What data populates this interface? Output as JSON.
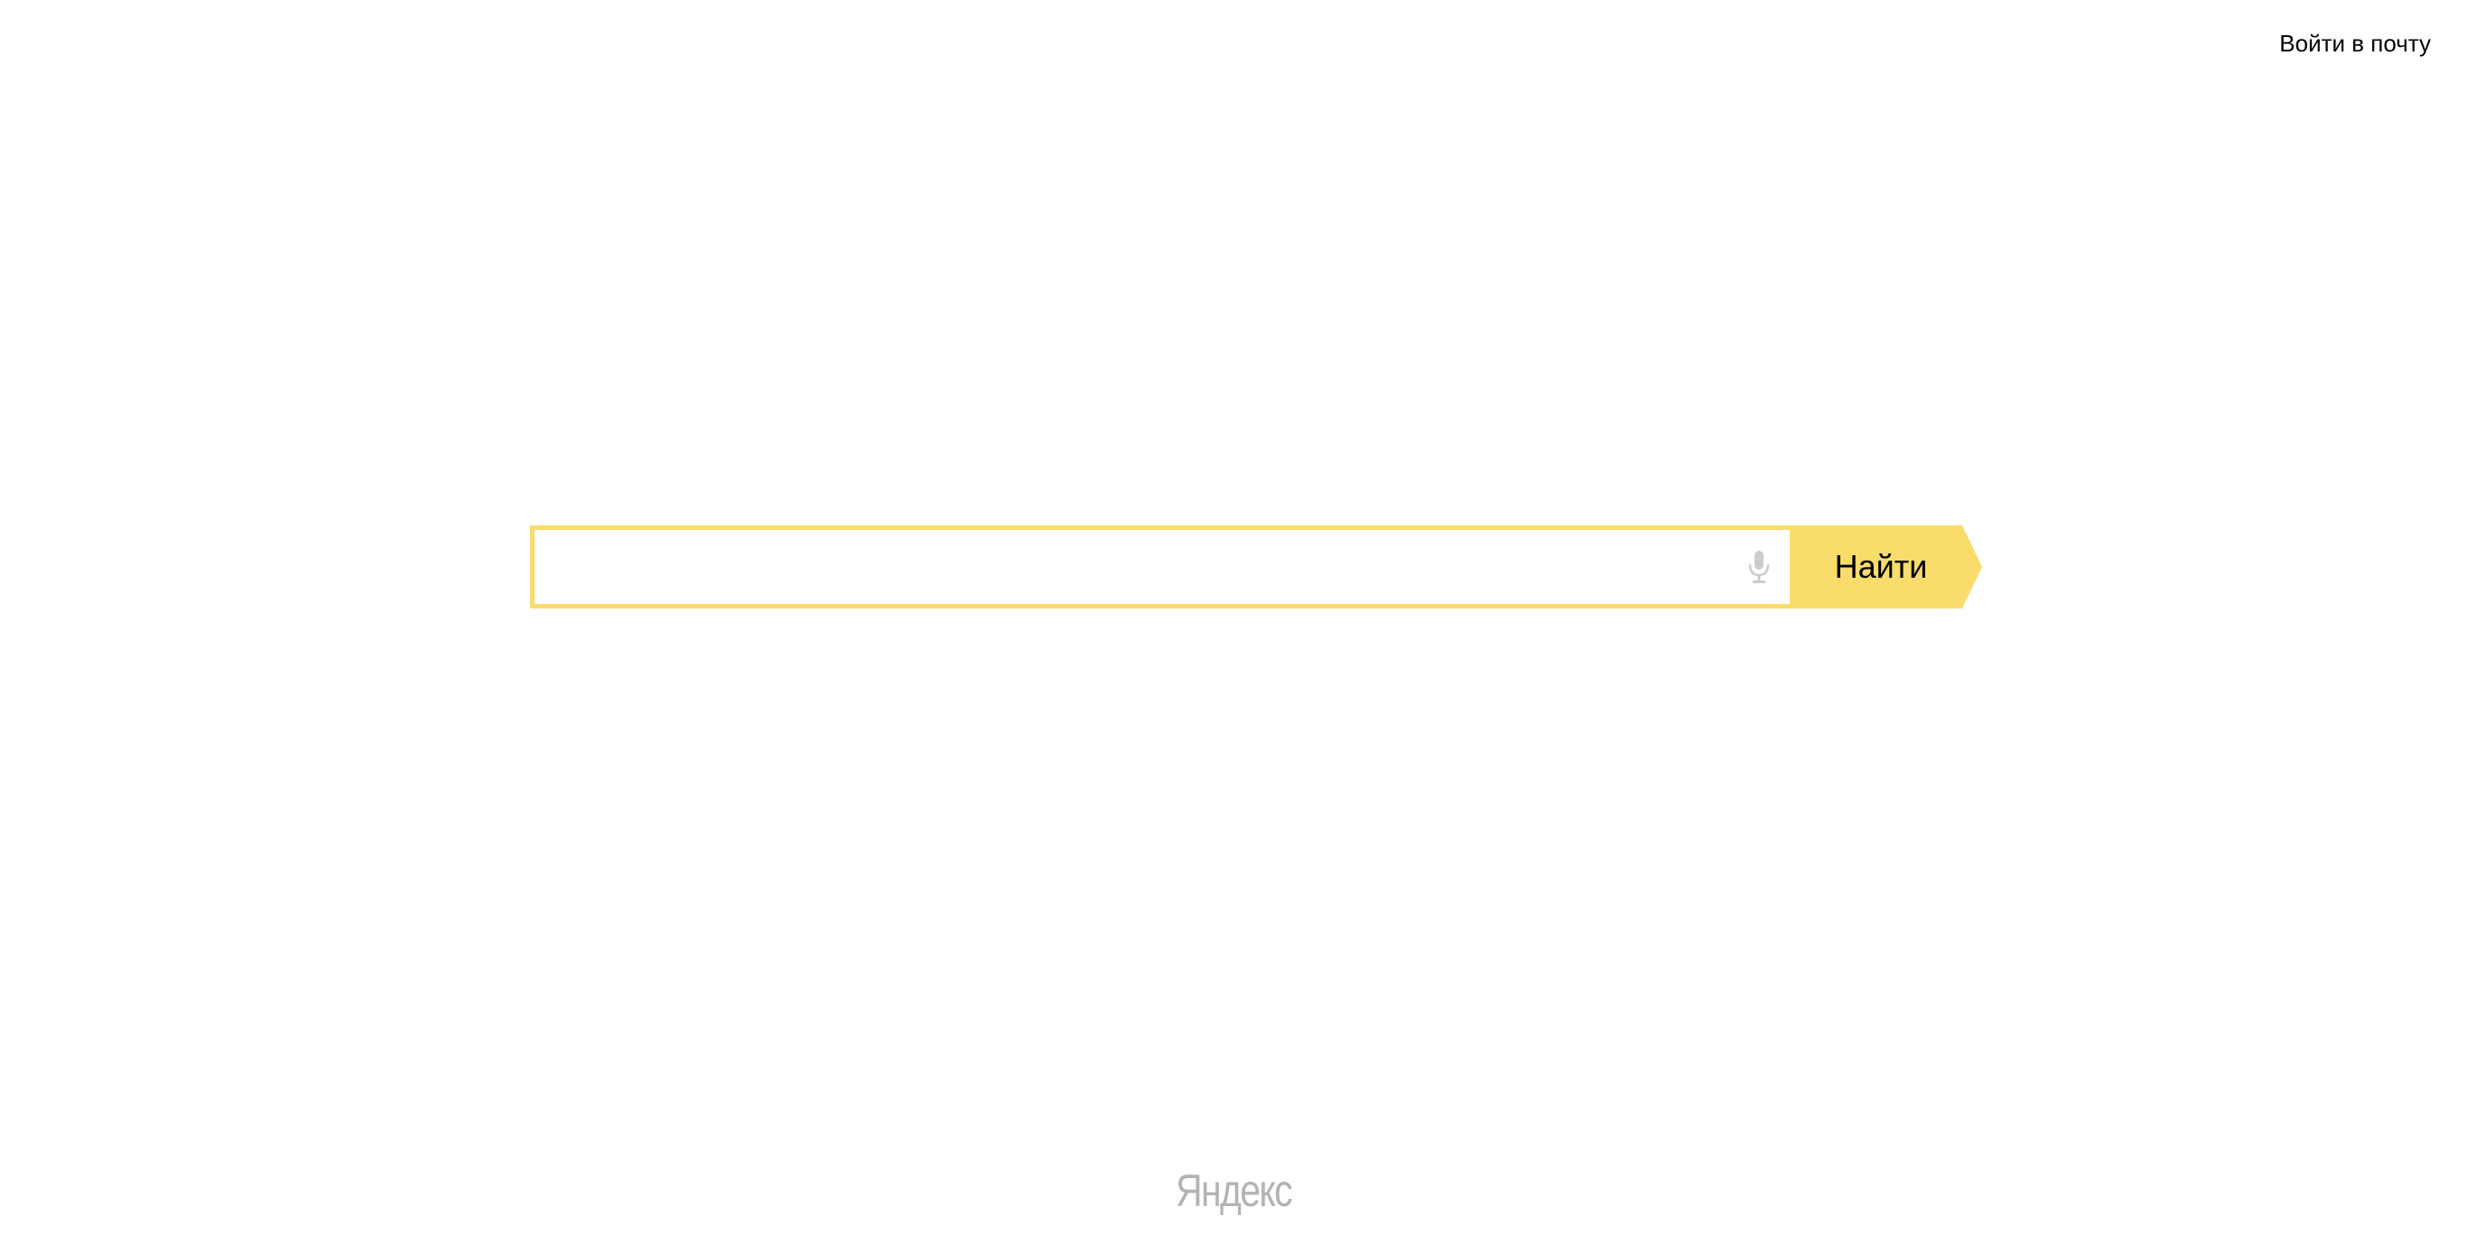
{
  "header": {
    "login_link": "Войти в почту"
  },
  "search": {
    "input_value": "",
    "placeholder": "",
    "button_label": "Найти",
    "mic_icon": "microphone-icon"
  },
  "footer": {
    "logo_text": "Яндекс"
  },
  "colors": {
    "accent": "#f9dc6b",
    "logo_gray": "#b3b3b3",
    "mic_gray": "#cccccc"
  }
}
